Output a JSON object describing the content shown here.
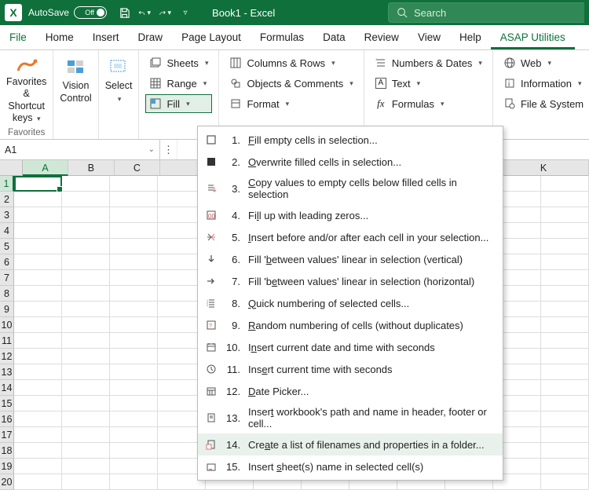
{
  "titlebar": {
    "autosave_label": "AutoSave",
    "autosave_state": "Off",
    "doc_title": "Book1 - Excel",
    "search_placeholder": "Search"
  },
  "tabs": [
    "File",
    "Home",
    "Insert",
    "Draw",
    "Page Layout",
    "Formulas",
    "Data",
    "Review",
    "View",
    "Help",
    "ASAP Utilities"
  ],
  "active_tab": "ASAP Utilities",
  "ribbon": {
    "favorites": {
      "label": "Favorites &\nShortcut keys",
      "group_title": "Favorites"
    },
    "vision": "Vision\nControl",
    "select": "Select",
    "col1": {
      "sheets": "Sheets",
      "range": "Range",
      "fill": "Fill"
    },
    "col2": {
      "colrows": "Columns & Rows",
      "objects": "Objects & Comments",
      "format": "Format"
    },
    "col3": {
      "numbers": "Numbers & Dates",
      "text": "Text",
      "formulas": "Formulas"
    },
    "col4": {
      "web": "Web",
      "info": "Information",
      "filesys": "File & System"
    }
  },
  "namebox": "A1",
  "columns": [
    "A",
    "B",
    "C",
    "",
    "K"
  ],
  "rows": [
    "1",
    "2",
    "3",
    "4",
    "5",
    "6",
    "7",
    "8",
    "9",
    "10",
    "11",
    "12",
    "13",
    "14",
    "15",
    "16",
    "17",
    "18",
    "19",
    "20"
  ],
  "menu": [
    {
      "n": "1.",
      "pre": "",
      "u": "F",
      "post": "ill empty cells in selection..."
    },
    {
      "n": "2.",
      "pre": "",
      "u": "O",
      "post": "verwrite filled cells in selection..."
    },
    {
      "n": "3.",
      "pre": "",
      "u": "C",
      "post": "opy values to empty cells below filled cells in selection"
    },
    {
      "n": "4.",
      "pre": "Fi",
      "u": "l",
      "post": "l up with leading zeros..."
    },
    {
      "n": "5.",
      "pre": "",
      "u": "I",
      "post": "nsert before and/or after each cell in your selection..."
    },
    {
      "n": "6.",
      "pre": "Fill '",
      "u": "b",
      "post": "etween values' linear in selection (vertical)"
    },
    {
      "n": "7.",
      "pre": "Fill 'b",
      "u": "e",
      "post": "tween values' linear in selection (horizontal)"
    },
    {
      "n": "8.",
      "pre": "",
      "u": "Q",
      "post": "uick numbering of selected cells..."
    },
    {
      "n": "9.",
      "pre": "",
      "u": "R",
      "post": "andom numbering of cells (without duplicates)"
    },
    {
      "n": "10.",
      "pre": "I",
      "u": "n",
      "post": "sert current date and time with seconds"
    },
    {
      "n": "11.",
      "pre": "Ins",
      "u": "e",
      "post": "rt current time with seconds"
    },
    {
      "n": "12.",
      "pre": "",
      "u": "D",
      "post": "ate Picker..."
    },
    {
      "n": "13.",
      "pre": "Inser",
      "u": "t",
      "post": " workbook's path and name in header, footer or cell..."
    },
    {
      "n": "14.",
      "pre": "Cre",
      "u": "a",
      "post": "te a list of filenames and properties in a folder..."
    },
    {
      "n": "15.",
      "pre": "Insert ",
      "u": "s",
      "post": "heet(s) name in selected cell(s)"
    }
  ],
  "menu_highlight_index": 13
}
